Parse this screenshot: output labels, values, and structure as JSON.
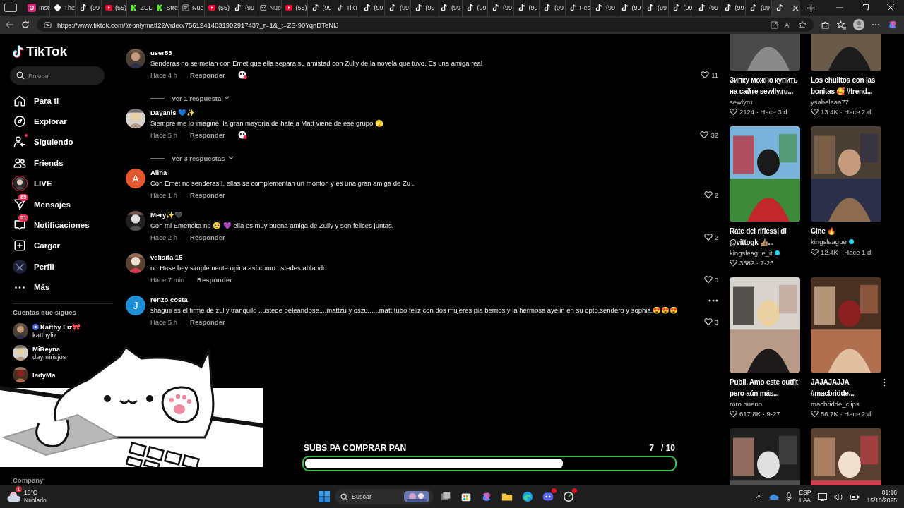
{
  "browser": {
    "tabs": [
      {
        "label": "Inst",
        "kind": "instagram",
        "selected": false
      },
      {
        "label": "The",
        "kind": "diamond",
        "selected": false
      },
      {
        "label": "(99",
        "kind": "tiktok",
        "selected": false
      },
      {
        "label": "(55)",
        "kind": "youtube",
        "selected": false
      },
      {
        "label": "ZUL",
        "kind": "kick",
        "selected": false
      },
      {
        "label": "Stre",
        "kind": "kick",
        "selected": false
      },
      {
        "label": "Nue",
        "kind": "page",
        "selected": false
      },
      {
        "label": "(55)",
        "kind": "youtube",
        "selected": false
      },
      {
        "label": "(99",
        "kind": "tiktok",
        "selected": false
      },
      {
        "label": "Nue",
        "kind": "mail",
        "selected": false
      },
      {
        "label": "(55)",
        "kind": "youtube",
        "selected": false
      },
      {
        "label": "(99",
        "kind": "tiktok",
        "selected": false
      },
      {
        "label": "TikT",
        "kind": "tiktok",
        "selected": false
      },
      {
        "label": "(99",
        "kind": "tiktok",
        "selected": false
      },
      {
        "label": "(99",
        "kind": "tiktok",
        "selected": false
      },
      {
        "label": "(99",
        "kind": "tiktok",
        "selected": false
      },
      {
        "label": "(99",
        "kind": "tiktok",
        "selected": false
      },
      {
        "label": "(99",
        "kind": "tiktok",
        "selected": false
      },
      {
        "label": "(99",
        "kind": "tiktok",
        "selected": false
      },
      {
        "label": "(99",
        "kind": "tiktok",
        "selected": false
      },
      {
        "label": "(99",
        "kind": "tiktok",
        "selected": false
      },
      {
        "label": "Pes",
        "kind": "tiktok",
        "selected": false
      },
      {
        "label": "(99",
        "kind": "tiktok",
        "selected": false
      },
      {
        "label": "(99",
        "kind": "tiktok",
        "selected": false
      },
      {
        "label": "(99",
        "kind": "tiktok",
        "selected": false
      },
      {
        "label": "(99",
        "kind": "tiktok",
        "selected": false
      },
      {
        "label": "(99",
        "kind": "tiktok",
        "selected": false
      },
      {
        "label": "(99",
        "kind": "tiktok",
        "selected": false
      },
      {
        "label": "(99",
        "kind": "tiktok",
        "selected": false
      },
      {
        "kind": "tiktok",
        "selected": true
      }
    ],
    "url": "https://www.tiktok.com/@onlymatt22/video/7561241483190291743?_r=1&_t=ZS-90YqnDTeNIJ"
  },
  "sidebar": {
    "logo": "TikTok",
    "search": {
      "placeholder": "Buscar"
    },
    "items": [
      {
        "label": "Para ti",
        "kind": "home",
        "dot": false
      },
      {
        "label": "Explorar",
        "kind": "compass",
        "dot": false
      },
      {
        "label": "Siguiendo",
        "kind": "following",
        "dot": true
      },
      {
        "label": "Friends",
        "kind": "friends",
        "dot": false
      },
      {
        "label": "LIVE",
        "kind": "live",
        "dot": false
      },
      {
        "label": "Mensajes",
        "kind": "messages",
        "dot": false,
        "badge": "65"
      },
      {
        "label": "Notificaciones",
        "kind": "notifications",
        "dot": false,
        "badge": "51"
      },
      {
        "label": "Cargar",
        "kind": "upload",
        "dot": false
      },
      {
        "label": "Perfil",
        "kind": "profile",
        "dot": false
      },
      {
        "label": "Más",
        "kind": "more",
        "dot": false
      }
    ],
    "following_title": "Cuentas que sigues",
    "following": [
      {
        "name": "Katthy Liz🎀",
        "handle": "katthyliz",
        "badge": true
      },
      {
        "name": "MiReyna",
        "handle": "daymirisjos",
        "badge": false
      },
      {
        "name": "ladyMa",
        "badge": false
      }
    ],
    "footer": "Company"
  },
  "comments": [
    {
      "name": "user53",
      "text": "Senderas no se metan con Emet que ella separa su amistad con Zully de la novela que tuvo. Es una amiga real",
      "time": "Hace 4 h",
      "reply": "Responder",
      "sticker": true,
      "likes": "11",
      "replies": "Ver 1 respuesta",
      "more_menu": false
    },
    {
      "name": "Dayanis 💙✨",
      "text": "Siempre me lo imaginé, la gran mayoría de hate a Matt viene de ese grupo 🫣",
      "time": "Hace 5 h",
      "reply": "Responder",
      "sticker": true,
      "likes": "32",
      "replies": "Ver 3 respuestas",
      "more_menu": false
    },
    {
      "avatar": {
        "kind": "letter",
        "letter": "A",
        "color": "#e4572e"
      },
      "name": "Alina",
      "text": "Con Emet no senderas!!, ellas se complementan un montón y es una gran amiga de Zu .",
      "time": "Hace 1 h",
      "reply": "Responder",
      "sticker": false,
      "likes": "2",
      "more_menu": false
    },
    {
      "name": "Mery✨🖤",
      "text": "Con mi Emettcita no 🥺 💜 ella es muy buena amiga de Zully y son felices juntas.",
      "time": "Hace 2 h",
      "reply": "Responder",
      "sticker": false,
      "likes": "2",
      "more_menu": false
    },
    {
      "name": "velisita 15",
      "text": "no Hase hey simplemente opina así como ustedes ablando",
      "time": "Hace 7 min",
      "reply": "Responder",
      "sticker": false,
      "likes": "0",
      "more_menu": false
    },
    {
      "avatar": {
        "kind": "letter",
        "letter": "J",
        "color": "#1e8fd6"
      },
      "name": "renzo costa",
      "text": "shaguii es el firme de zully tranquilo ..ustede peleandose....mattzu y oszu......matt tubo feliz con dos mujeres pia berrios y la hermosa ayelin en su dpto.sendero y sophia.😍😍😍",
      "time": "Hace 5 h",
      "reply": "Responder",
      "sticker": false,
      "likes": "3",
      "more_menu": true
    }
  ],
  "videos": [
    {
      "kind": "video",
      "title": "Зипку можно купить на сайте sewlly.ru...",
      "author": "sewlyru",
      "verified": false,
      "stats": "2124 · Hace 3 d",
      "more_menu": false
    },
    {
      "kind": "video",
      "title": "Los chulitos con las bonitas 🥰 #trend...",
      "author": "ysabelaaa77",
      "verified": false,
      "stats": "13.4K · Hace 2 d",
      "more_menu": false
    },
    {
      "kind": "video",
      "title": "Rate dei riflessi di @vittogk 👍🏽...",
      "author": "kingsleague_it",
      "verified": true,
      "stats": "3582 · 7-26",
      "more_menu": false
    },
    {
      "kind": "video",
      "title": "Cine 🔥",
      "author": "kingsleague",
      "verified": true,
      "stats": "12.4K · Hace 1 d",
      "more_menu": false
    },
    {
      "kind": "video",
      "title": "Publi. Amo este outfit pero aún más...",
      "author": "roro.bueno",
      "verified": false,
      "stats": "617.8K · 9-27",
      "more_menu": false
    },
    {
      "kind": "video",
      "title": "JAJAJAJJA #macbridde...",
      "author": "macbridde_clips",
      "verified": false,
      "stats": "56.7K · Hace 2 d",
      "more_menu": true
    },
    {
      "kind": "thumbnail"
    },
    {
      "kind": "thumbnail"
    }
  ],
  "overlay": {
    "goal": {
      "title": "SUBS PA COMPRAR PAN",
      "current": "7",
      "total": "/ 10",
      "level": 0.7
    }
  },
  "taskbar": {
    "weather": {
      "temp": "18°C",
      "condition": "Nublado",
      "badge": "1"
    },
    "search": {
      "placeholder": "Buscar"
    },
    "apps": [
      {
        "kind": "taskview",
        "badge": false
      },
      {
        "kind": "store",
        "badge": false
      },
      {
        "kind": "copilot",
        "badge": false
      },
      {
        "kind": "files",
        "badge": false
      },
      {
        "kind": "edge",
        "badge": false
      },
      {
        "kind": "discord",
        "badge": true
      },
      {
        "kind": "app",
        "badge": true
      }
    ],
    "language": "ESP",
    "layout": "LAA",
    "time": "01:16",
    "date": "15/10/2025"
  }
}
